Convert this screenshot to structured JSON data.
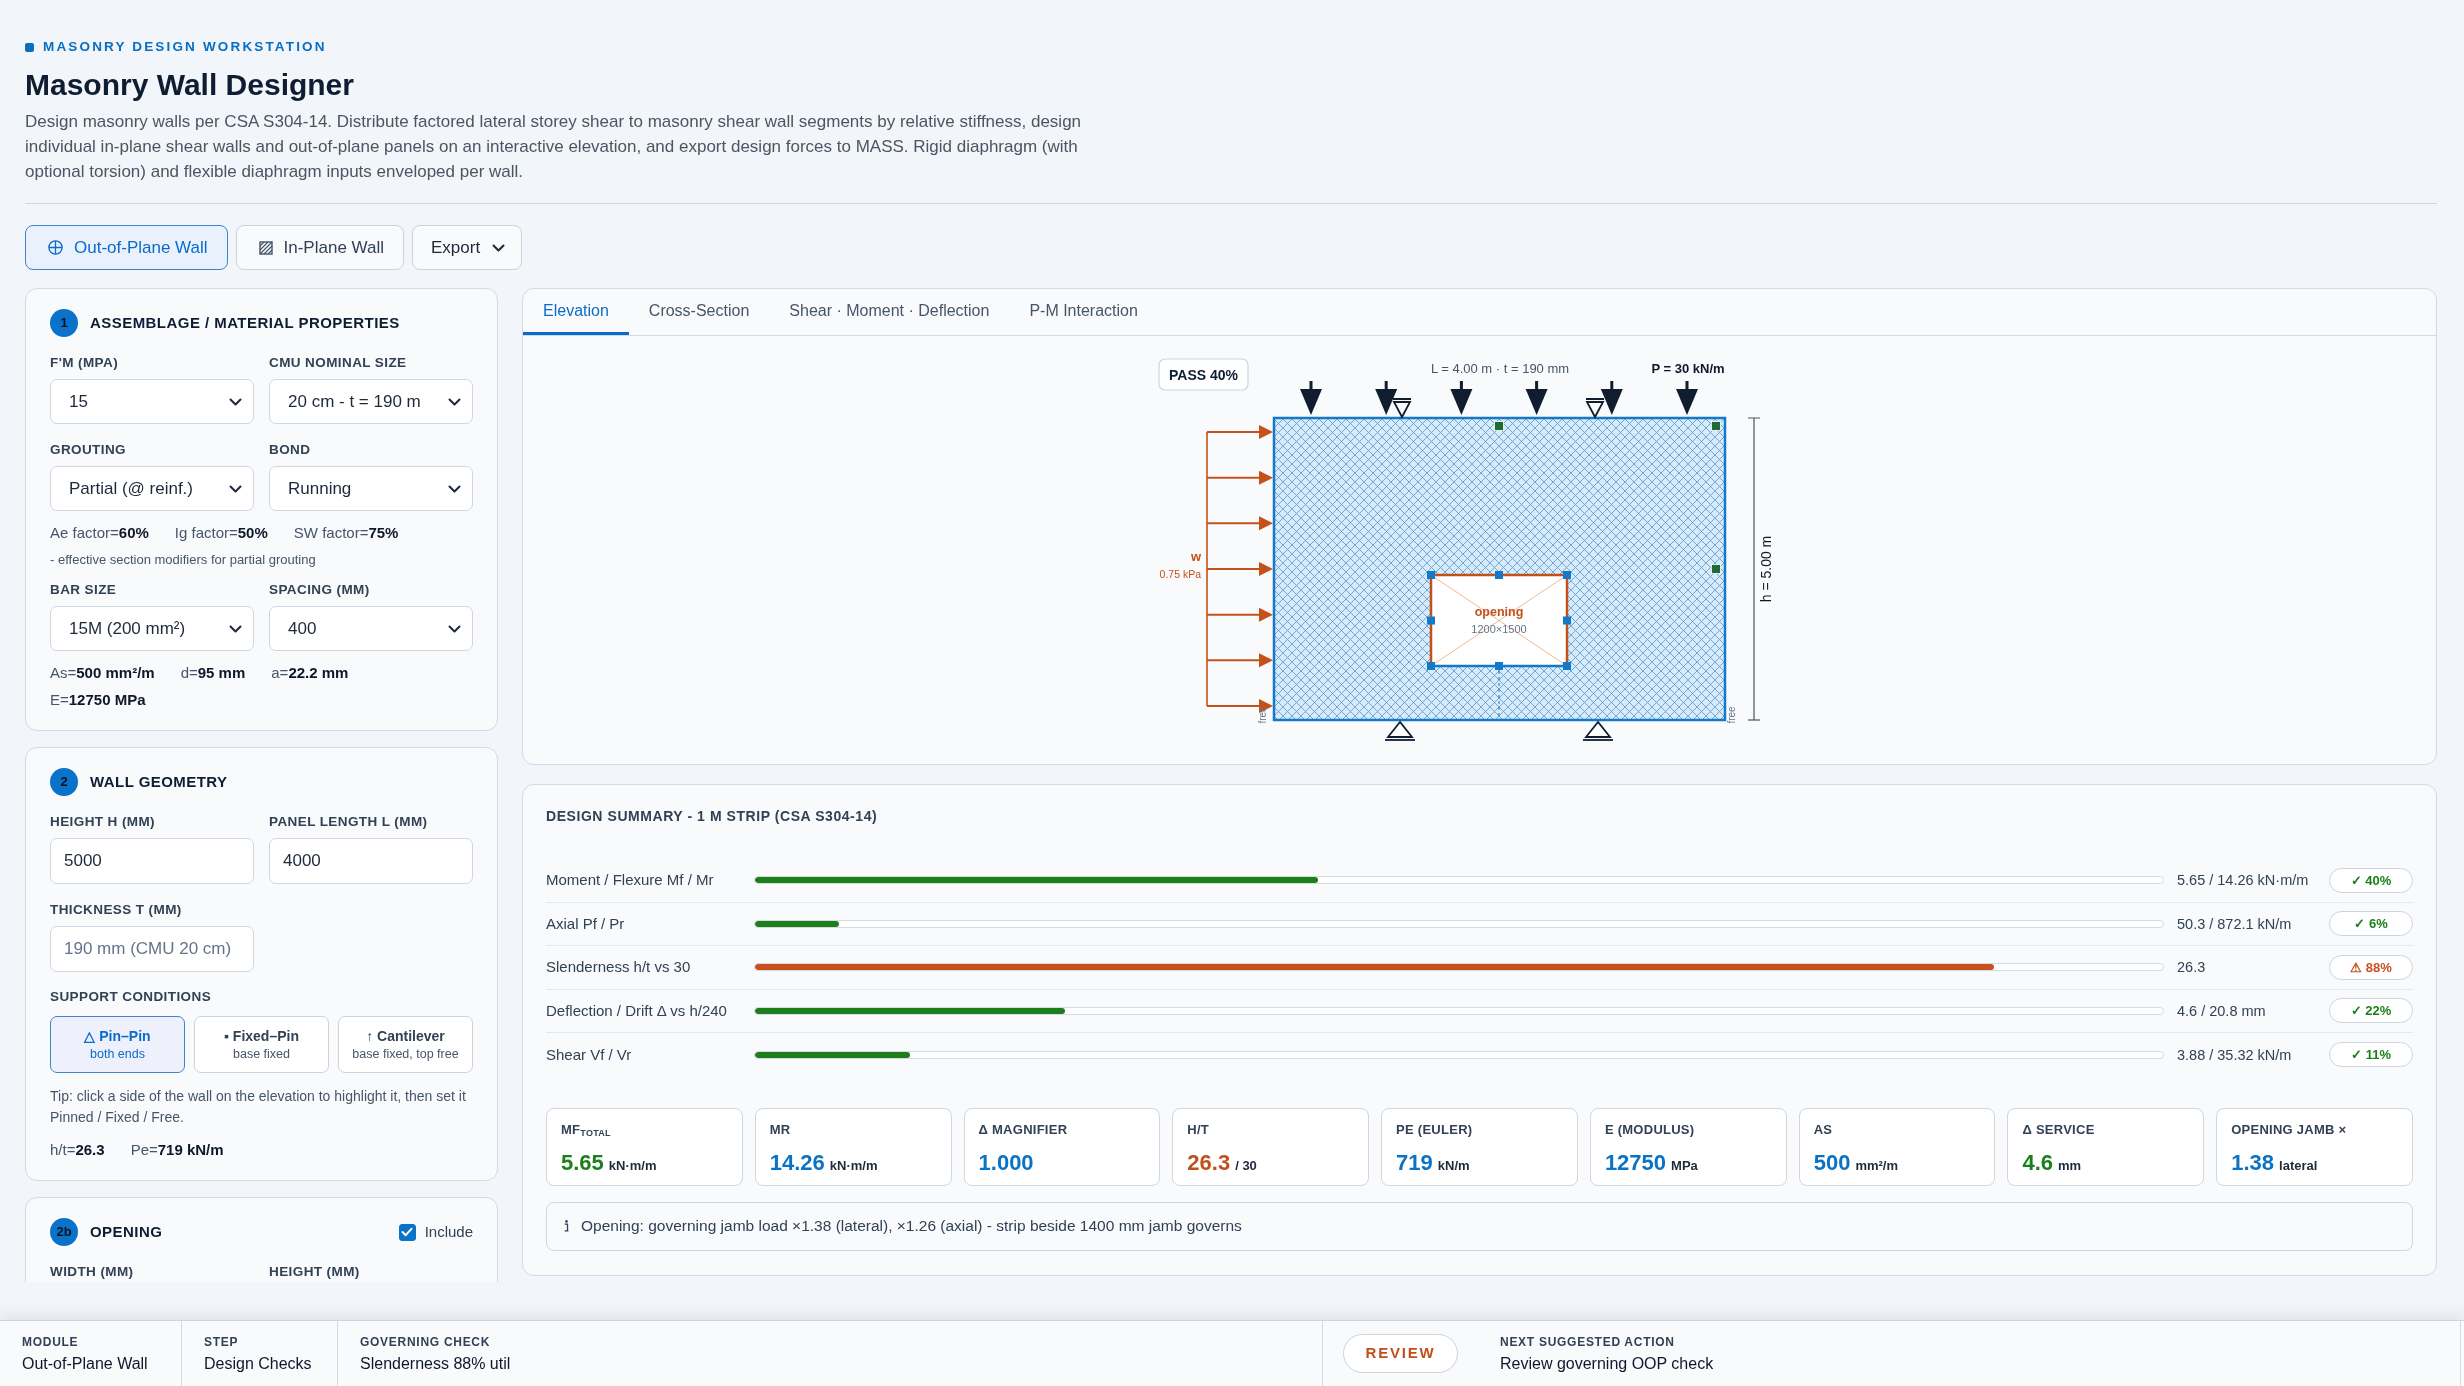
{
  "header": {
    "eyebrow": "MASONRY DESIGN WORKSTATION",
    "title": "Masonry Wall Designer",
    "description": "Design masonry walls per CSA S304-14. Distribute factored lateral storey shear to masonry shear wall segments by relative stiffness, design individual in-plane shear walls and out-of-plane panels on an interactive elevation, and export design forces to MASS. Rigid diaphragm (with optional torsion) and flexible diaphragm inputs enveloped per wall."
  },
  "toolbar": {
    "modes": [
      {
        "label": "Out-of-Plane Wall",
        "selected": true
      },
      {
        "label": "In-Plane Wall",
        "selected": false
      }
    ],
    "export": {
      "label": "Export"
    }
  },
  "panels": [
    {
      "number": "1",
      "title": "ASSEMBLAGE / MATERIAL PROPERTIES",
      "blocks": [
        {
          "kind": "fields",
          "fields": [
            {
              "label": "F'M (MPA)",
              "kind": "select",
              "value": "15"
            },
            {
              "label": "CMU NOMINAL SIZE",
              "kind": "select",
              "value": "20 cm - t = 190 m"
            }
          ]
        },
        {
          "kind": "fields",
          "fields": [
            {
              "label": "GROUTING",
              "kind": "select",
              "value": "Partial (@ reinf.)"
            },
            {
              "label": "BOND",
              "kind": "select",
              "value": "Running"
            }
          ]
        },
        {
          "kind": "facts",
          "items": [
            "Ae factor=**60%**",
            "Ig factor=**50%**",
            "SW factor=**75%**"
          ]
        },
        {
          "kind": "note",
          "text": "- effective section modifiers for partial grouting"
        },
        {
          "kind": "fields",
          "fields": [
            {
              "label": "BAR SIZE",
              "kind": "select",
              "value": "15M (200 mm²)"
            },
            {
              "label": "SPACING (MM)",
              "kind": "select",
              "value": "400"
            }
          ]
        },
        {
          "kind": "facts",
          "items": [
            "As=**500 mm²/m**",
            "d=**95 mm**",
            "a=**22.2 mm**"
          ]
        },
        {
          "kind": "facts",
          "items": [
            "E=**12750 MPa**"
          ]
        }
      ]
    },
    {
      "number": "2",
      "title": "WALL GEOMETRY",
      "blocks": [
        {
          "kind": "fields",
          "fields": [
            {
              "label": "HEIGHT H (MM)",
              "kind": "input",
              "value": "5000"
            },
            {
              "label": "PANEL LENGTH L (MM)",
              "kind": "input",
              "value": "4000"
            }
          ]
        },
        {
          "kind": "fields",
          "fields": [
            {
              "label": "THICKNESS T (MM)",
              "kind": "input",
              "placeholder": "190 mm (CMU 20 cm)"
            }
          ]
        },
        {
          "kind": "supports",
          "label": "SUPPORT CONDITIONS",
          "options": [
            {
              "title": "△ Pin–Pin",
              "subtitle": "both ends",
              "selected": true
            },
            {
              "title": "▪ Fixed–Pin",
              "subtitle": "base fixed",
              "selected": false
            },
            {
              "title": "↑ Cantilever",
              "subtitle": "base fixed, top free",
              "selected": false
            }
          ]
        },
        {
          "kind": "tip",
          "text": "Tip: click a side of the wall on the elevation to highlight it, then set it Pinned / Fixed / Free."
        },
        {
          "kind": "facts",
          "items": [
            "h/t=**26.3**",
            "Pe=**719 kN/m**"
          ]
        }
      ]
    },
    {
      "number": "2b",
      "title": "OPENING",
      "toggle": {
        "label": "Include",
        "checked": true
      },
      "blocks": [
        {
          "kind": "fields",
          "fields": [
            {
              "label": "WIDTH (MM)",
              "kind": "label"
            },
            {
              "label": "HEIGHT (MM)",
              "kind": "label"
            }
          ]
        }
      ]
    }
  ],
  "view_tabs": [
    {
      "label": "Elevation",
      "selected": true
    },
    {
      "label": "Cross-Section",
      "selected": false
    },
    {
      "label": "Shear · Moment · Deflection",
      "selected": false
    },
    {
      "label": "P-M Interaction",
      "selected": false
    }
  ],
  "elevation": {
    "badge": "PASS 40%",
    "span_label": "L = 4.00 m · t = 190 mm",
    "axial_load": "P = 30 kN/m",
    "lateral_load": {
      "symbol": "w",
      "magnitude": "0.75 kPa"
    },
    "opening": {
      "label": "opening",
      "size": "1200×1500"
    },
    "edge_labels": [
      "free",
      "free"
    ],
    "height_label": "h = 5.00 m"
  },
  "summary": {
    "title": "DESIGN SUMMARY - 1 M STRIP (CSA S304-14)",
    "checks": [
      {
        "label": "Moment / Flexure Mf / Mr",
        "level": 0.4,
        "reading": "5.65 / 14.26 kN·m/m",
        "kind": "pass",
        "badge": "✓ 40%"
      },
      {
        "label": "Axial Pf / Pr",
        "level": 0.06,
        "reading": "50.3 / 872.1 kN/m",
        "kind": "pass",
        "badge": "✓ 6%"
      },
      {
        "label": "Slenderness h/t vs 30",
        "level": 0.88,
        "reading": "26.3",
        "kind": "warn",
        "badge": "⚠ 88%"
      },
      {
        "label": "Deflection / Drift Δ vs h/240",
        "level": 0.22,
        "reading": "4.6 / 20.8 mm",
        "kind": "pass",
        "badge": "✓ 22%"
      },
      {
        "label": "Shear Vf / Vr",
        "level": 0.11,
        "reading": "3.88 / 35.32 kN/m",
        "kind": "pass",
        "badge": "✓ 11%"
      }
    ],
    "metrics": [
      {
        "label": "MF$_{TOTAL}$",
        "value": "5.65",
        "unit": "kN·m/m",
        "color": "#1c7f1c"
      },
      {
        "label": "MR",
        "value": "14.26",
        "unit": "kN·m/m",
        "color": "#0b72c4"
      },
      {
        "label": "Δ MAGNIFIER",
        "value": "1.000",
        "color": "#0b72c4"
      },
      {
        "label": "H/T",
        "value": "26.3",
        "unit": "/ 30",
        "color": "#c2501a"
      },
      {
        "label": "PE (EULER)",
        "value": "719",
        "unit": "kN/m",
        "color": "#0b72c4"
      },
      {
        "label": "E (MODULUS)",
        "value": "12750",
        "unit": "MPa",
        "color": "#0b72c4"
      },
      {
        "label": "AS",
        "value": "500",
        "unit": "mm²/m",
        "color": "#0b72c4"
      },
      {
        "label": "Δ SERVICE",
        "value": "4.6",
        "unit": "mm",
        "color": "#1c7f1c"
      },
      {
        "label": "OPENING JAMB ×",
        "value": "1.38",
        "unit": "lateral",
        "color": "#0b72c4"
      }
    ],
    "note": "Opening: governing jamb load ×1.38 (lateral), ×1.26 (axial) - strip beside 1400 mm jamb governs"
  },
  "status_bar": {
    "cells": [
      {
        "label": "MODULE",
        "value": "Out-of-Plane Wall"
      },
      {
        "label": "STEP",
        "value": "Design Checks"
      },
      {
        "label": "GOVERNING CHECK",
        "value": "Slenderness 88% util"
      }
    ],
    "badge": "REVIEW",
    "next_action": {
      "label": "NEXT SUGGESTED ACTION",
      "value": "Review governing OOP check"
    }
  }
}
